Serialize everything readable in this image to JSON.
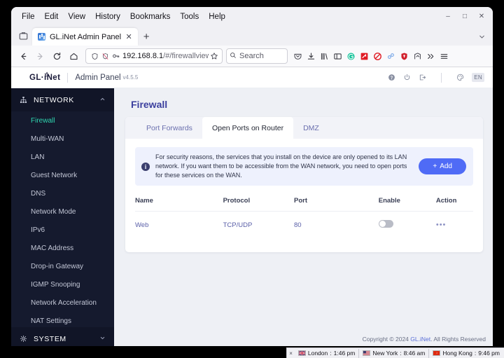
{
  "browser": {
    "menus": [
      "File",
      "Edit",
      "View",
      "History",
      "Bookmarks",
      "Tools",
      "Help"
    ],
    "window_controls": [
      {
        "name": "minimize",
        "glyph": "–"
      },
      {
        "name": "maximize",
        "glyph": "□"
      },
      {
        "name": "close",
        "glyph": "✕"
      }
    ],
    "firefox_view_icon": "firefox-view-icon",
    "tab": {
      "title": "GL.iNet Admin Panel",
      "close_glyph": "✕",
      "favicon": "gl-inet-favicon"
    },
    "new_tab_glyph": "+",
    "list_all_tabs_glyph": "ˇ",
    "nav": {
      "back": "←",
      "forward": "→",
      "reload": "↻",
      "home": "⌂"
    },
    "url": {
      "host": "192.168.8.1",
      "path": "/#/firewallview",
      "shield_icon": "shield-icon",
      "tracker_blocked_icon": "tracking-protection-off-icon",
      "key_icon": "key-icon",
      "bookmark_icon": "bookmark-star-icon"
    },
    "search": {
      "placeholder": "Search",
      "icon": "search-icon"
    },
    "toolbar_icons": [
      "pocket-icon",
      "downloads-icon",
      "library-icon",
      "sidebars-icon",
      "grammarly-extension-icon",
      "ublock-origin-extension-icon",
      "adblock-extension-icon",
      "linkclump-extension-icon",
      "bitwarden-extension-icon",
      "save-to-extension-icon",
      "overflow-chevrons-icon",
      "app-menu-icon"
    ]
  },
  "app": {
    "brand": "GL·iNet",
    "title": "Admin Panel",
    "version": "v4.5.5",
    "header_icons": [
      "help-icon",
      "power-icon",
      "logout-icon",
      "theme-palette-icon"
    ],
    "language": "EN"
  },
  "sidebar": {
    "group": {
      "label": "NETWORK",
      "icon": "network-tree-icon",
      "chevron": "ⱏ"
    },
    "items": [
      {
        "label": "Firewall",
        "active": true
      },
      {
        "label": "Multi-WAN",
        "active": false
      },
      {
        "label": "LAN",
        "active": false
      },
      {
        "label": "Guest Network",
        "active": false
      },
      {
        "label": "DNS",
        "active": false
      },
      {
        "label": "Network Mode",
        "active": false
      },
      {
        "label": "IPv6",
        "active": false
      },
      {
        "label": "MAC Address",
        "active": false
      },
      {
        "label": "Drop-in Gateway",
        "active": false
      },
      {
        "label": "IGMP Snooping",
        "active": false
      },
      {
        "label": "Network Acceleration",
        "active": false
      },
      {
        "label": "NAT Settings",
        "active": false
      }
    ],
    "bottom_group": {
      "label": "SYSTEM",
      "icon": "system-gear-icon",
      "chevron": "ⱏ"
    }
  },
  "page": {
    "title": "Firewall",
    "tabs": [
      {
        "label": "Port Forwards",
        "active": false
      },
      {
        "label": "Open Ports on Router",
        "active": true
      },
      {
        "label": "DMZ",
        "active": false
      }
    ],
    "banner": {
      "icon": "info-icon",
      "text": "For security reasons, the services that you install on the device are only opened to its LAN network. If you want them to be accessible from the WAN network, you need to open ports for these services on the WAN.",
      "add_button": {
        "label": "Add",
        "plus": "+",
        "color": "#4f6bf6"
      }
    },
    "table": {
      "headers": [
        "Name",
        "Protocol",
        "Port",
        "Enable",
        "Action"
      ],
      "rows": [
        {
          "name": "Web",
          "protocol": "TCP/UDP",
          "port": "80",
          "enabled": false,
          "action_icon": "more-options-icon",
          "action_glyph": "•••"
        }
      ]
    },
    "footer": {
      "prefix": "Copyright © 2024 ",
      "link": "GL.iNet",
      "suffix": ". All Rights Reserved"
    }
  },
  "statusbar": {
    "close_glyph": "×",
    "clocks": [
      {
        "city": "London",
        "time": "1:46 pm",
        "flag": "uk-flag-icon"
      },
      {
        "city": "New York",
        "time": "8:46 am",
        "flag": "us-flag-icon"
      },
      {
        "city": "Hong Kong",
        "time": "9:46 pm",
        "flag": "hk-flag-icon"
      }
    ]
  },
  "colors": {
    "accent": "#4f6bf6",
    "sidebar_bg": "#151a2e",
    "active_item": "#2fd6b0",
    "page_title": "#3b3f9e"
  }
}
